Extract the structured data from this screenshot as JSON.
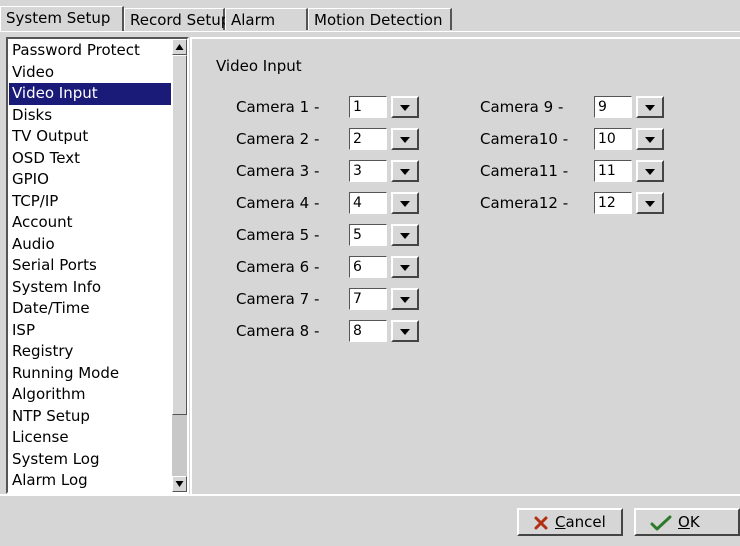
{
  "tabs": [
    {
      "label": "System Setup",
      "active": true
    },
    {
      "label": "Record Setup",
      "active": false
    },
    {
      "label": "Alarm",
      "active": false
    },
    {
      "label": "Motion Detection",
      "active": false
    }
  ],
  "sidebar": {
    "selected": "Video Input",
    "items": [
      "Password Protect",
      "Video",
      "Video Input",
      "Disks",
      "TV Output",
      "OSD Text",
      "GPIO",
      "TCP/IP",
      "Account",
      "Audio",
      "Serial Ports",
      "System Info",
      "Date/Time",
      "ISP",
      "Registry",
      "Running Mode",
      "Algorithm",
      "NTP Setup",
      "License",
      "System Log",
      "Alarm Log"
    ]
  },
  "panel": {
    "title": "Video Input",
    "cameras_left": [
      {
        "label": "Camera 1 -",
        "value": "1"
      },
      {
        "label": "Camera 2 -",
        "value": "2"
      },
      {
        "label": "Camera 3 -",
        "value": "3"
      },
      {
        "label": "Camera 4 -",
        "value": "4"
      },
      {
        "label": "Camera 5 -",
        "value": "5"
      },
      {
        "label": "Camera 6 -",
        "value": "6"
      },
      {
        "label": "Camera 7 -",
        "value": "7"
      },
      {
        "label": "Camera 8 -",
        "value": "8"
      }
    ],
    "cameras_right": [
      {
        "label": "Camera 9 -",
        "value": "9"
      },
      {
        "label": "Camera10 -",
        "value": "10"
      },
      {
        "label": "Camera11 -",
        "value": "11"
      },
      {
        "label": "Camera12 -",
        "value": "12"
      }
    ]
  },
  "buttons": {
    "cancel": {
      "mnemonic": "C",
      "rest": "ancel",
      "icon": "x-icon"
    },
    "ok": {
      "mnemonic": "O",
      "rest": "K",
      "icon": "check-icon"
    }
  },
  "colors": {
    "selection": "#1a1a78",
    "background": "#d6d6d6",
    "cancel_icon": "#b03010",
    "ok_icon": "#2d7a2d"
  }
}
